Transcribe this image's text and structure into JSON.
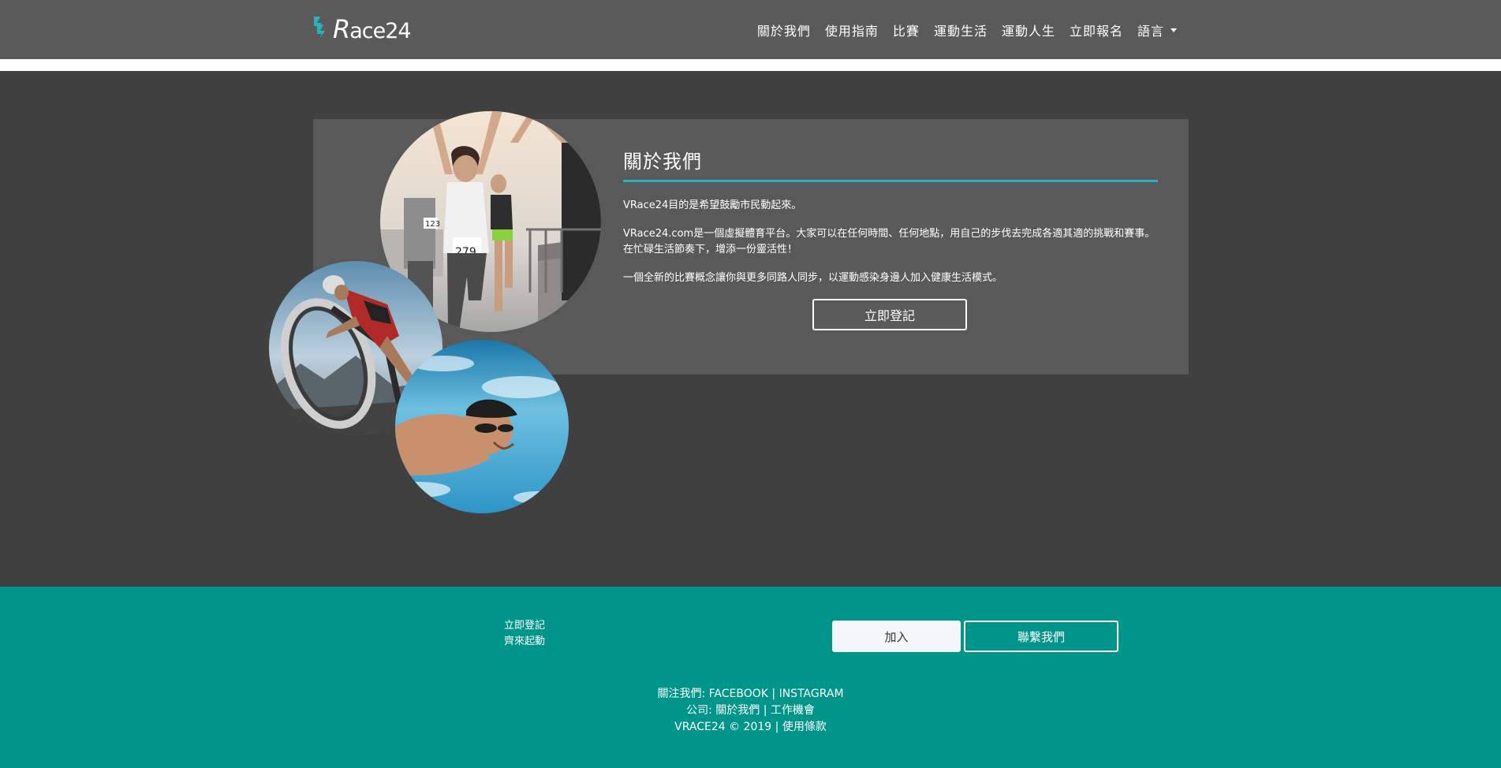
{
  "header": {
    "logo_text_r": "R",
    "logo_text_rest": "ace24",
    "nav": [
      {
        "label": "關於我們"
      },
      {
        "label": "使用指南"
      },
      {
        "label": "比賽"
      },
      {
        "label": "運動生活"
      },
      {
        "label": "運動人生"
      },
      {
        "label": "立即報名"
      },
      {
        "label": "語言"
      }
    ]
  },
  "about": {
    "title": "關於我們",
    "para1": "VRace24目的是希望鼓勵市民動起來。",
    "para2": "VRace24.com是一個虛擬體育平台。大家可以在任何時間、任何地點，用自己的步伐去完成各適其適的挑戰和賽事。在忙碌生活節奏下，增添一份靈活性！",
    "para3": "一個全新的比賽概念讓你與更多同路人同步，以運動感染身邊人加入健康生活模式。",
    "register_label": "立即登記",
    "bib_numbers": [
      "123",
      "279"
    ]
  },
  "footer": {
    "link1": "立即登記",
    "link2": "齊來起動",
    "join_label": "加入",
    "contact_label": "聯繫我們",
    "follow_prefix": "關注我們: ",
    "facebook": "FACEBOOK",
    "sep": " | ",
    "instagram": "INSTAGRAM",
    "company_prefix": "公司: ",
    "about_link": "關於我們",
    "jobs_link": "工作機會",
    "copyright": "VRACE24 © 2019",
    "terms": "使用條款"
  },
  "colors": {
    "accent": "#26b3bb",
    "footer_bg": "#00958a",
    "header_bg": "#5a5a5a",
    "page_bg": "#404040"
  }
}
